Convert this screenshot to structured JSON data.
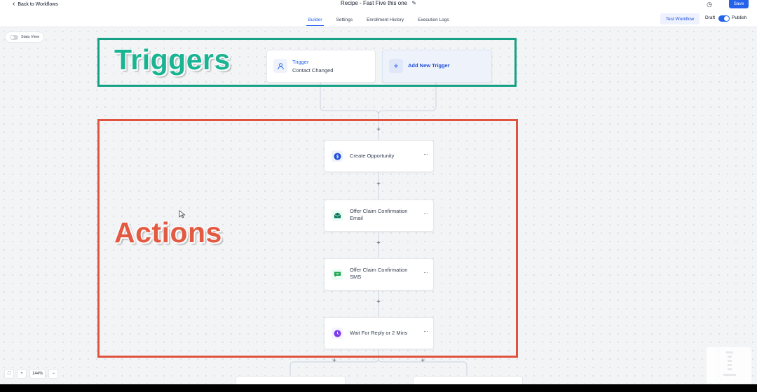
{
  "header": {
    "back_label": "Back to Workflows",
    "title": "Recipe - Fast Five this one",
    "tabs": [
      {
        "label": "Builder",
        "active": true
      },
      {
        "label": "Settings",
        "active": false
      },
      {
        "label": "Enrollment History",
        "active": false
      },
      {
        "label": "Execution Logs",
        "active": false
      }
    ],
    "test_workflow_label": "Test Workflow",
    "draft_label": "Draft",
    "publish_label": "Publish",
    "save_label": "Save"
  },
  "canvas": {
    "stats_view_label": "Stats View",
    "triggers_overlay_label": "Triggers",
    "actions_overlay_label": "Actions",
    "trigger_card": {
      "title": "Trigger",
      "subtitle": "Contact Changed"
    },
    "add_trigger_label": "Add New Trigger",
    "actions": [
      {
        "label": "Create Opportunity",
        "icon": "dollar-icon",
        "color": "#1d4ed8"
      },
      {
        "label": "Offer Claim Confirmation Email",
        "icon": "envelope-icon",
        "color": "#047857"
      },
      {
        "label": "Offer Claim Confirmation SMS",
        "icon": "sms-icon",
        "color": "#16a34a"
      },
      {
        "label": "Wait For Reply or 2 Mins",
        "icon": "clock-icon",
        "color": "#7c3aed"
      }
    ]
  },
  "zoom": {
    "level": "144%"
  },
  "colors": {
    "accent": "#2563eb",
    "triggers_box": "#16a085",
    "actions_box": "#e0533f"
  }
}
